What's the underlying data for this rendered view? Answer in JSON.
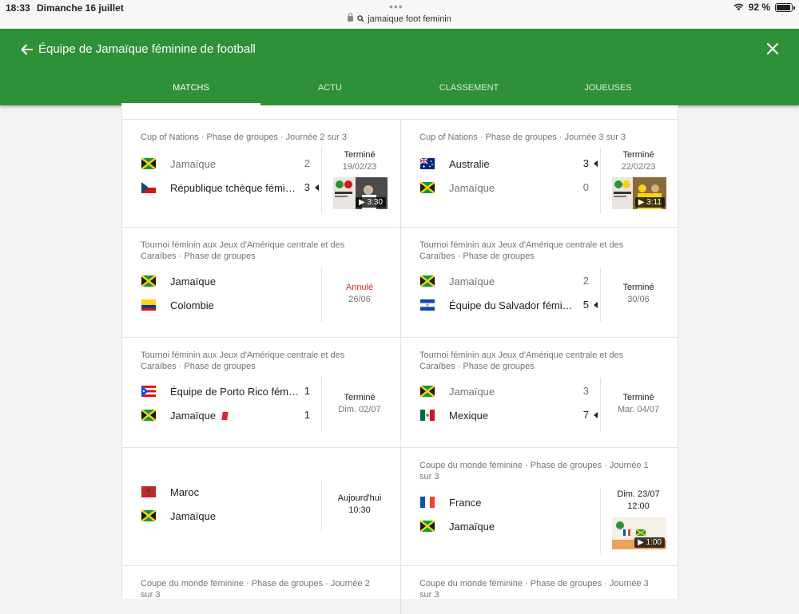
{
  "status_bar": {
    "time": "18:33",
    "date": "Dimanche 16 juillet",
    "url": "jamaique foot feminin",
    "battery": "92 %"
  },
  "header": {
    "title": "Équipe de Jamaïque féminine de football",
    "tabs": [
      {
        "label": "MATCHS",
        "active": true
      },
      {
        "label": "ACTU",
        "active": false
      },
      {
        "label": "CLASSEMENT",
        "active": false
      },
      {
        "label": "JOUEUSES",
        "active": false
      }
    ]
  },
  "colors": {
    "header_green": "#2f9137",
    "cancelled_red": "#d93025"
  },
  "matches": [
    {
      "competition": "Cup of Nations · Phase de groupes · Journée 2 sur 3",
      "team1": {
        "name": "Jamaïque",
        "flag": "jamaica-flag",
        "score": "2"
      },
      "team2": {
        "name": "République tchèque fémi…",
        "flag": "czech-flag",
        "score": "3"
      },
      "status": "Terminé",
      "date": "19/02/23",
      "video_duration": "3:30"
    },
    {
      "competition": "Cup of Nations · Phase de groupes · Journée 3 sur 3",
      "team1": {
        "name": "Australie",
        "flag": "australia-flag",
        "score": "3"
      },
      "team2": {
        "name": "Jamaïque",
        "flag": "jamaica-flag",
        "score": "0"
      },
      "status": "Terminé",
      "date": "22/02/23",
      "video_duration": "3:11"
    },
    {
      "competition": "Tournoi féminin aux Jeux d'Amérique centrale et des Caraïbes · Phase de groupes",
      "team1": {
        "name": "Jamaïque",
        "flag": "jamaica-flag"
      },
      "team2": {
        "name": "Colombie",
        "flag": "colombia-flag"
      },
      "status": "Annulé",
      "date": "26/06"
    },
    {
      "competition": "Tournoi féminin aux Jeux d'Amérique centrale et des Caraïbes · Phase de groupes",
      "team1": {
        "name": "Jamaïque",
        "flag": "jamaica-flag",
        "score": "2"
      },
      "team2": {
        "name": "Équipe du Salvador fémi…",
        "flag": "el-salvador-flag",
        "score": "5"
      },
      "status": "Terminé",
      "date": "30/06"
    },
    {
      "competition": "Tournoi féminin aux Jeux d'Amérique centrale et des Caraïbes · Phase de groupes",
      "team1": {
        "name": "Équipe de Porto Rico fém…",
        "flag": "puerto-rico-flag",
        "score": "1"
      },
      "team2": {
        "name": "Jamaïque",
        "flag": "jamaica-flag",
        "score": "1"
      },
      "status": "Terminé",
      "date": "Dim. 02/07"
    },
    {
      "competition": "Tournoi féminin aux Jeux d'Amérique centrale et des Caraïbes · Phase de groupes",
      "team1": {
        "name": "Jamaïque",
        "flag": "jamaica-flag",
        "score": "3"
      },
      "team2": {
        "name": "Mexique",
        "flag": "mexico-flag",
        "score": "7"
      },
      "status": "Terminé",
      "date": "Mar. 04/07"
    },
    {
      "competition": "",
      "team1": {
        "name": "Maroc",
        "flag": "morocco-flag"
      },
      "team2": {
        "name": "Jamaïque",
        "flag": "jamaica-flag"
      },
      "status": "Aujourd'hui",
      "date": "10:30"
    },
    {
      "competition": "Coupe du monde féminine · Phase de groupes · Journée 1 sur 3",
      "team1": {
        "name": "France",
        "flag": "france-flag"
      },
      "team2": {
        "name": "Jamaïque",
        "flag": "jamaica-flag"
      },
      "status": "Dim. 23/07",
      "date": "12:00",
      "video_duration": "1:00"
    },
    {
      "competition": "Coupe du monde féminine · Phase de groupes · Journée 2 sur 3"
    },
    {
      "competition": "Coupe du monde féminine · Phase de groupes · Journée 3 sur 3"
    }
  ]
}
